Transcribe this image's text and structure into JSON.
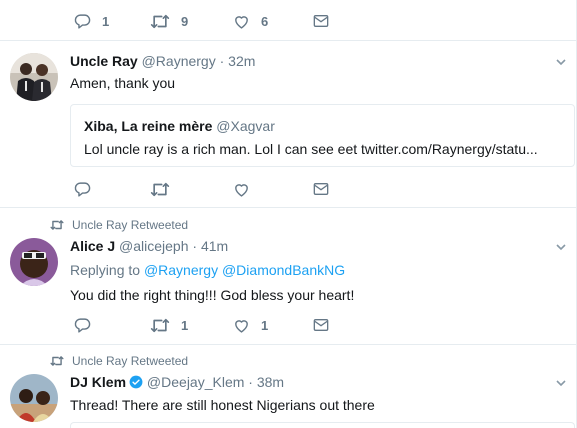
{
  "colors": {
    "accent": "#1da1f2",
    "muted": "#657786",
    "border": "#e6ecf0",
    "text": "#14171a"
  },
  "top_actions": {
    "reply_count": "1",
    "retweet_count": "9",
    "like_count": "6"
  },
  "tweet1": {
    "name": "Uncle Ray",
    "handle": "@Raynergy",
    "time": "· 32m",
    "text": "Amen, thank you",
    "quote": {
      "name": "Xiba, La reine mère",
      "handle": "@Xagvar",
      "text": "Lol uncle ray is a rich man. Lol I can see eet twitter.com/Raynergy/statu..."
    }
  },
  "tweet2": {
    "retweet_context": "Uncle Ray Retweeted",
    "name": "Alice J",
    "handle": "@alicejeph",
    "time": "· 41m",
    "replying_to_label": "Replying to",
    "reply_mention_1": "@Raynergy",
    "reply_mention_2": "@DiamondBankNG",
    "text": "You did the right thing!!! God bless your heart!",
    "retweet_count": "1",
    "like_count": "1"
  },
  "tweet3": {
    "retweet_context": "Uncle Ray Retweeted",
    "name": "DJ Klem",
    "handle": "@Deejay_Klem",
    "time": "· 38m",
    "text": "Thread! There are still honest Nigerians out there"
  }
}
